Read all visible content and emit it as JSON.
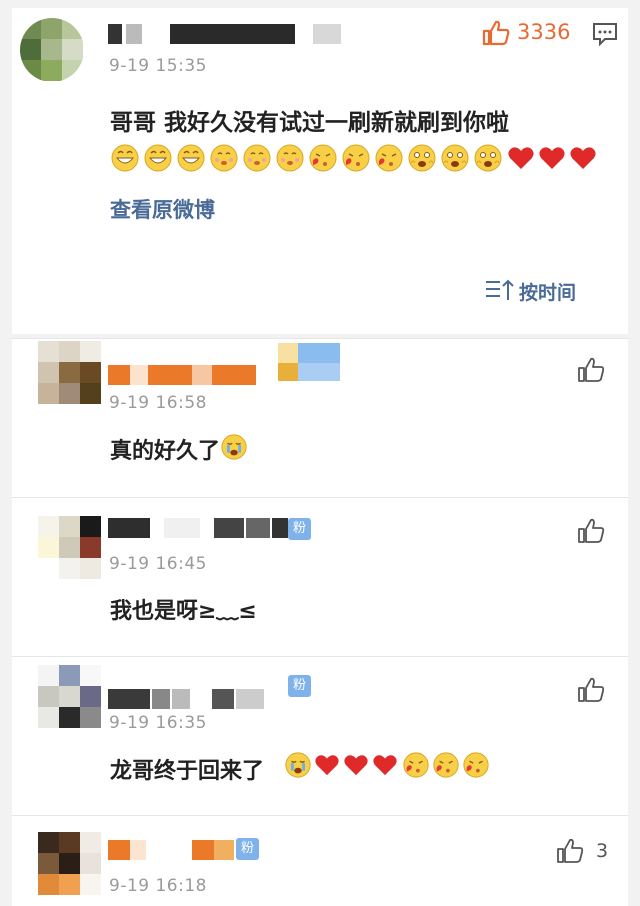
{
  "post": {
    "time": "9-19 15:35",
    "likes": "3336",
    "text": "哥哥 我好久没有试过一刷新就刷到你啦",
    "emojis": [
      "grin",
      "grin",
      "grin",
      "blush",
      "blush",
      "blush",
      "kiss",
      "kiss",
      "kiss",
      "cry-happy",
      "cry-happy",
      "cry-happy",
      "heart",
      "heart",
      "heart"
    ],
    "view_original": "查看原微博",
    "sort_label": "按时间",
    "accent_color": "#e86a33",
    "link_color": "#4a6b97"
  },
  "comments": [
    {
      "time": "9-19 16:58",
      "text": "真的好久了",
      "emojis": [
        "cry"
      ],
      "likes": ""
    },
    {
      "time": "9-19 16:45",
      "text": "我也是呀≥﹏≤",
      "emojis": [],
      "likes": "",
      "badge": "粉"
    },
    {
      "time": "9-19 16:35",
      "text": "龙哥终于回来了",
      "emojis": [
        "cry",
        "heart",
        "heart",
        "heart",
        "kiss",
        "kiss",
        "kiss"
      ],
      "likes": "",
      "badge": "粉"
    },
    {
      "time": "9-19 16:18",
      "text": "",
      "emojis": [],
      "likes": "3",
      "badge": "粉"
    }
  ]
}
